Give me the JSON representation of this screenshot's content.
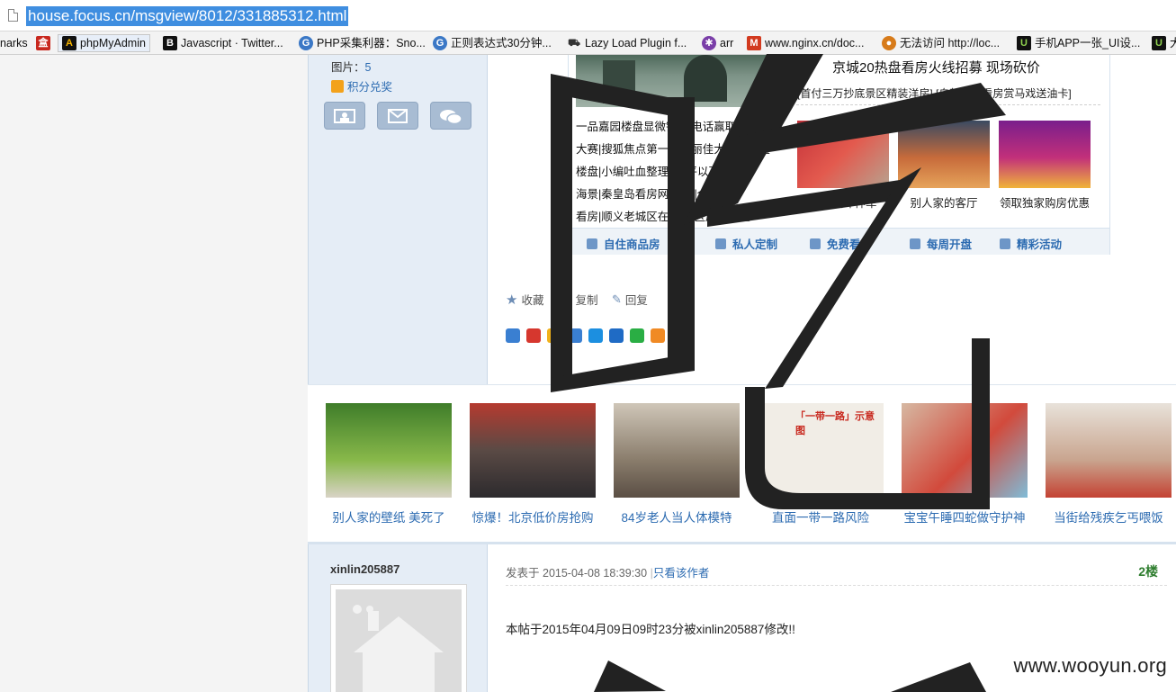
{
  "address_bar": {
    "url": "house.focus.cn/msgview/8012/331885312.html"
  },
  "bookmarks": [
    {
      "label": "narks",
      "icon": "truncated"
    },
    {
      "label": "",
      "icon": "red-box-icon",
      "color": "#c8281e"
    },
    {
      "label": "phpMyAdmin",
      "icon": "phpmyadmin-icon",
      "color": "#e8a400"
    },
    {
      "label": "Javascript · Twitter...",
      "icon": "bold-b-icon",
      "color": "#111111"
    },
    {
      "label": "PHP采集利器：Sno...",
      "icon": "globe-icon",
      "color": "#3b78c6"
    },
    {
      "label": "正则表达式30分钟...",
      "icon": "globe-icon",
      "color": "#3b78c6"
    },
    {
      "label": "Lazy Load Plugin f...",
      "icon": "car-icon",
      "color": "#333333"
    },
    {
      "label": "arr",
      "icon": "bug-icon",
      "color": "#7a3ea8"
    },
    {
      "label": "www.nginx.cn/doc...",
      "icon": "mario-icon",
      "color": "#d23a1f"
    },
    {
      "label": "无法访问 http://loc...",
      "icon": "sun-icon",
      "color": "#d77b1a"
    },
    {
      "label": "手机APP一张_UI设...",
      "icon": "ui-icon",
      "color": "#2c8b22"
    },
    {
      "label": "大",
      "icon": "ui-icon",
      "color": "#2c8b22"
    }
  ],
  "sidebar1": {
    "images_label": "图片：",
    "images_count": "5",
    "points_label": "积分兑奖"
  },
  "ad": {
    "headline": "京城20热盘看房火线招募  现场砍价",
    "subline": "[首付三万抄底景区精装洋房] [自驾香河看房赏马戏送油卡]",
    "list": [
      "一品嘉园楼盘显微镜|打电话赢取大奖",
      "大赛|搜狐焦点第一届美丽佳大赛报名啦",
      "楼盘|小编吐血整理|万/平以下楼盘",
      "海景|秦皇岛看房网|报名|全包",
      "看房|顺义老城区在|铁学区房配套全"
    ],
    "tiles": [
      {
        "caption": "野狗咬坏神车"
      },
      {
        "caption": "别人家的客厅"
      },
      {
        "caption": "领取独家购房优惠"
      }
    ],
    "tabs": [
      "自住商品房",
      "私人定制",
      "免费看房",
      "每周开盘",
      "精彩活动"
    ]
  },
  "post_ops": {
    "favorite": "收藏",
    "copy": "复制",
    "reply": "回复"
  },
  "strip": [
    {
      "caption": "别人家的壁纸 美死了"
    },
    {
      "caption": "惊爆！北京低价房抢购"
    },
    {
      "caption": "84岁老人当人体模特"
    },
    {
      "caption": "直面一带一路风险"
    },
    {
      "caption": "宝宝午睡四蛇做守护神"
    },
    {
      "caption": "当街给残疾乞丐喂饭"
    }
  ],
  "strip_tile_text": "「一带一路」示意图",
  "post2": {
    "author": "xinlin205887",
    "posted_prefix": "发表于",
    "posted_at": "2015-04-08 18:39:30",
    "only_author": "只看该作者",
    "floor": "2楼",
    "body": "本帖于2015年04月09日09时23分被xinlin205887修改!!"
  },
  "overlay": {
    "glyph": "吃",
    "watermark": "www.wooyun.org"
  },
  "colors": {
    "link": "#2c6bb1",
    "url_highlight": "#3f8ee0",
    "sidebar_bg": "#e5edf6",
    "floor": "#2e7d2e"
  }
}
